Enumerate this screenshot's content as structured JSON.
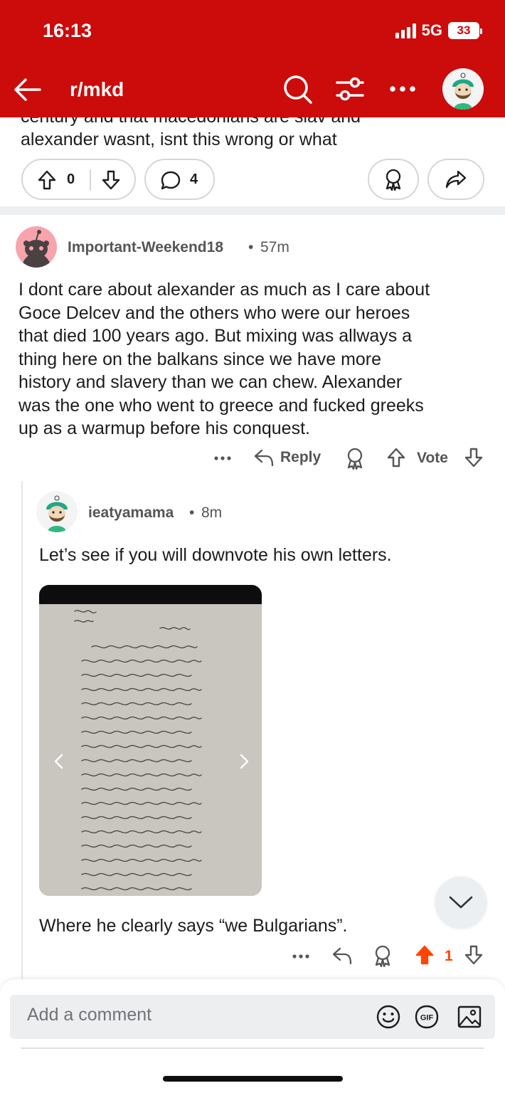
{
  "status_bar": {
    "time": "16:13",
    "network": "5G",
    "battery": "33"
  },
  "nav": {
    "subreddit": "r/mkd",
    "back_icon": "back-arrow-icon",
    "search_icon": "search-icon",
    "filter_icon": "filter-icon",
    "more_icon": "more-horizontal-icon"
  },
  "post": {
    "text_line1": "century and that macedonians are slav and",
    "text_line2": "alexander wasnt, isnt this wrong or what",
    "votes": "0",
    "comments": "4"
  },
  "comment1": {
    "username": "Important-Weekend18",
    "time": "57m",
    "lines": [
      "I dont care about alexander as much as I care about",
      "Goce Delcev and the others who were our heroes",
      "that died 100 years ago. But mixing was allways a",
      "thing here on the balkans since we have more",
      "history and slavery than we can chew. Alexander",
      "was the one who went to greece and fucked greeks",
      "up as a warmup before his conquest."
    ],
    "reply_label": "Reply",
    "vote_label": "Vote"
  },
  "comment2": {
    "username": "ieatyamama",
    "time": "8m",
    "text1": "Let’s see if you will downvote his own letters.",
    "text2": "Where he clearly says “we Bulgarians”.",
    "votes": "1",
    "upvote_color": "#ff4500"
  },
  "composer": {
    "placeholder": "Add a comment"
  },
  "colors": {
    "header": "#cc0b0b",
    "upvote": "#ff4500"
  }
}
